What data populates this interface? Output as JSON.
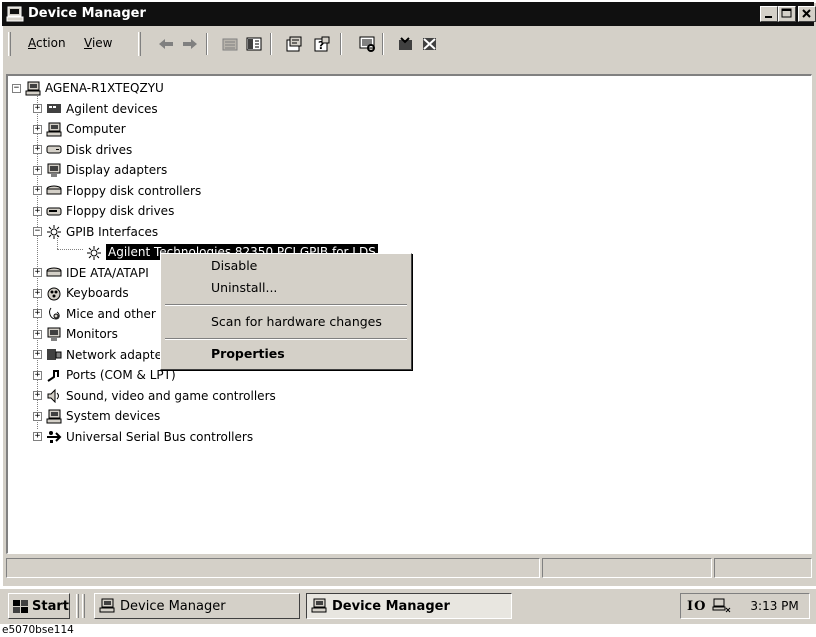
{
  "window": {
    "title": "Device Manager"
  },
  "menu": {
    "action": "Action",
    "action_key": "A",
    "action_rest": "ction",
    "view": "View",
    "view_key": "V",
    "view_rest": "iew"
  },
  "toolbar": {
    "buttons": [
      "back-arrow-icon",
      "forward-arrow-icon",
      "up-folder-icon",
      "show-hide-tree-icon",
      "properties-icon",
      "help-icon",
      "scan-hardware-icon",
      "update-driver-icon",
      "uninstall-icon"
    ]
  },
  "tree": {
    "root": "AGENA-R1XTEQZYU",
    "items": [
      {
        "label": "Agilent devices",
        "expander": "+"
      },
      {
        "label": "Computer",
        "expander": "+"
      },
      {
        "label": "Disk drives",
        "expander": "+"
      },
      {
        "label": "Display adapters",
        "expander": "+"
      },
      {
        "label": "Floppy disk controllers",
        "expander": "+"
      },
      {
        "label": "Floppy disk drives",
        "expander": "+"
      },
      {
        "label": "GPIB Interfaces",
        "expander": "−"
      },
      {
        "label": "Agilent Technologies 82350 PCI GPIB for LDS",
        "child": true,
        "selected": true
      },
      {
        "label": "IDE ATA/ATAPI",
        "expander": "+"
      },
      {
        "label": "Keyboards",
        "expander": "+"
      },
      {
        "label": "Mice and other p",
        "expander": "+"
      },
      {
        "label": "Monitors",
        "expander": "+"
      },
      {
        "label": "Network adapte",
        "expander": "+"
      },
      {
        "label": "Ports (COM & LPT)",
        "expander": "+"
      },
      {
        "label": "Sound, video and game controllers",
        "expander": "+"
      },
      {
        "label": "System devices",
        "expander": "+"
      },
      {
        "label": "Universal Serial Bus controllers",
        "expander": "+"
      }
    ]
  },
  "context_menu": {
    "disable": "Disable",
    "uninstall": "Uninstall...",
    "scan": "Scan for hardware changes",
    "properties": "Properties"
  },
  "taskbar": {
    "start": "Start",
    "tasks": [
      "Device Manager",
      "Device Manager"
    ],
    "tray_text": "IO",
    "clock": "3:13 PM"
  },
  "caption": "e5070bse114",
  "colors": {
    "titlebar": "#101010",
    "face": "#d4d0c8",
    "selection": "#000000"
  }
}
